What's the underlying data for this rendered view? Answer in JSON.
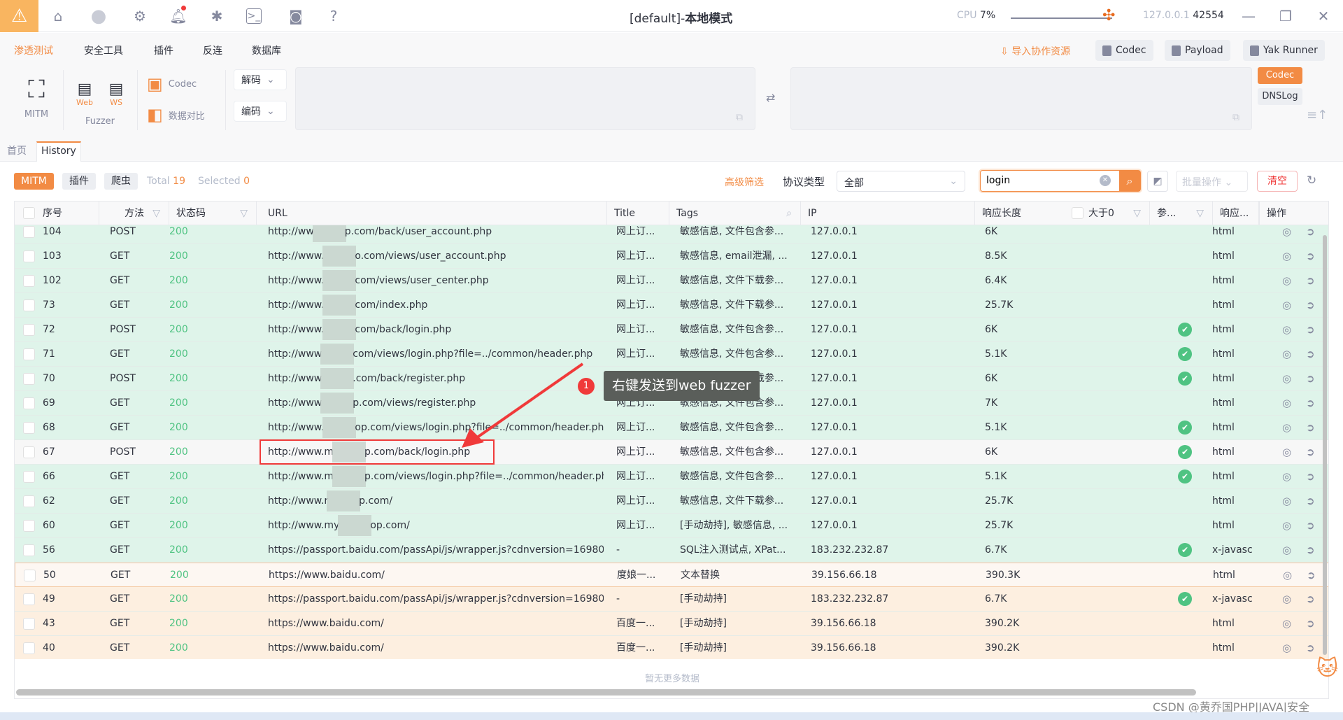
{
  "titlebar": {
    "title_prefix": "[default]-",
    "title_mode": "本地模式",
    "cpu_label": "CPU",
    "cpu_value": "7%",
    "host": "127.0.0.1",
    "port": "42554",
    "icons": [
      "warning-icon",
      "home-icon",
      "avatar-icon",
      "gear-icon",
      "bell-icon",
      "bug-icon",
      "terminal-icon",
      "camera-icon",
      "help-icon"
    ]
  },
  "menu": {
    "items": [
      "渗透测试",
      "安全工具",
      "插件",
      "反连",
      "数据库"
    ],
    "import_label": "导入协作资源",
    "buttons": [
      "Codec",
      "Payload",
      "Yak Runner"
    ]
  },
  "tools": {
    "mitm": "MITM",
    "fuzzer": "Fuzzer",
    "web": "Web",
    "ws": "WS",
    "codec": "Codec",
    "compare": "数据对比",
    "decode": "解码",
    "encode": "编码",
    "side_tabs": [
      "Codec",
      "DNSLog"
    ]
  },
  "tabs": [
    "首页",
    "History"
  ],
  "filter": {
    "pills": [
      "MITM",
      "插件",
      "爬虫"
    ],
    "total_label": "Total",
    "total": "19",
    "selected_label": "Selected",
    "selected": "0",
    "advanced": "高级筛选",
    "protocol_label": "协议类型",
    "protocol_value": "全部",
    "search_value": "login",
    "batch": "批量操作",
    "clear": "清空"
  },
  "table": {
    "headers": [
      "序号",
      "方法",
      "状态码",
      "URL",
      "Title",
      "Tags",
      "IP",
      "响应长度",
      "大于0",
      "参...",
      "响应...",
      "操作"
    ],
    "rows": [
      {
        "id": "104",
        "method": "POST",
        "status": "200",
        "url_pre": "http://ww",
        "url_suf": "p.com/back/user_account.php",
        "title": "网上订...",
        "tags": "敏感信息, 文件包含参...",
        "ip": "127.0.0.1",
        "len": "6K",
        "param": false,
        "type": "html",
        "bg": "green"
      },
      {
        "id": "103",
        "method": "GET",
        "status": "200",
        "url_pre": "http://www.",
        "url_suf": "o.com/views/user_account.php",
        "title": "网上订...",
        "tags": "敏感信息, email泄漏, ...",
        "ip": "127.0.0.1",
        "len": "8.5K",
        "param": false,
        "type": "html",
        "bg": "green"
      },
      {
        "id": "102",
        "method": "GET",
        "status": "200",
        "url_pre": "http://www.",
        "url_suf": "com/views/user_center.php",
        "title": "网上订...",
        "tags": "敏感信息, 文件下载参...",
        "ip": "127.0.0.1",
        "len": "6.4K",
        "param": false,
        "type": "html",
        "bg": "green"
      },
      {
        "id": "73",
        "method": "GET",
        "status": "200",
        "url_pre": "http://www.",
        "url_suf": "com/index.php",
        "title": "网上订...",
        "tags": "敏感信息, 文件下载参...",
        "ip": "127.0.0.1",
        "len": "25.7K",
        "param": false,
        "type": "html",
        "bg": "green"
      },
      {
        "id": "72",
        "method": "POST",
        "status": "200",
        "url_pre": "http://www.",
        "url_suf": "com/back/login.php",
        "title": "网上订...",
        "tags": "敏感信息, 文件包含参...",
        "ip": "127.0.0.1",
        "len": "6K",
        "param": true,
        "type": "html",
        "bg": "green"
      },
      {
        "id": "71",
        "method": "GET",
        "status": "200",
        "url_pre": "http://www",
        "url_suf": "com/views/login.php?file=../common/header.php",
        "title": "网上订...",
        "tags": "敏感信息, 文件包含参...",
        "ip": "127.0.0.1",
        "len": "5.1K",
        "param": true,
        "type": "html",
        "bg": "green"
      },
      {
        "id": "70",
        "method": "POST",
        "status": "200",
        "url_pre": "http://www",
        "url_suf": ".com/back/register.php",
        "title": "网上订...",
        "tags": "敏感信息, 文件下载参...",
        "ip": "127.0.0.1",
        "len": "6K",
        "param": true,
        "type": "html",
        "bg": "green"
      },
      {
        "id": "69",
        "method": "GET",
        "status": "200",
        "url_pre": "http://www",
        "url_suf": "p.com/views/register.php",
        "title": "网上订...",
        "tags": "敏感信息, 文件包含参...",
        "ip": "127.0.0.1",
        "len": "7K",
        "param": false,
        "type": "html",
        "bg": "green"
      },
      {
        "id": "68",
        "method": "GET",
        "status": "200",
        "url_pre": "http://www.",
        "url_suf": "op.com/views/login.php?file=../common/header.php",
        "title": "网上订...",
        "tags": "敏感信息, 文件包含参...",
        "ip": "127.0.0.1",
        "len": "5.1K",
        "param": true,
        "type": "html",
        "bg": "green"
      },
      {
        "id": "67",
        "method": "POST",
        "status": "200",
        "url_pre": "http://www.m",
        "url_suf": "p.com/back/login.php",
        "title": "网上订...",
        "tags": "敏感信息, 文件包含参...",
        "ip": "127.0.0.1",
        "len": "6K",
        "param": true,
        "type": "html",
        "bg": "selected"
      },
      {
        "id": "66",
        "method": "GET",
        "status": "200",
        "url_pre": "http://www.m",
        "url_suf": "p.com/views/login.php?file=../common/header.php",
        "title": "网上订...",
        "tags": "敏感信息, 文件包含参...",
        "ip": "127.0.0.1",
        "len": "5.1K",
        "param": true,
        "type": "html",
        "bg": "green"
      },
      {
        "id": "62",
        "method": "GET",
        "status": "200",
        "url_pre": "http://www.r",
        "url_suf": "p.com/",
        "title": "网上订...",
        "tags": "敏感信息, 文件下载参...",
        "ip": "127.0.0.1",
        "len": "25.7K",
        "param": false,
        "type": "html",
        "bg": "green"
      },
      {
        "id": "60",
        "method": "GET",
        "status": "200",
        "url_pre": "http://www.my",
        "url_suf": "op.com/",
        "title": "网上订...",
        "tags": "[手动劫持], 敏感信息, ...",
        "ip": "127.0.0.1",
        "len": "25.7K",
        "param": false,
        "type": "html",
        "bg": "green"
      },
      {
        "id": "56",
        "method": "GET",
        "status": "200",
        "url_pre": "https://passport.baidu.com/passApi/js/wrapper.js?cdnversion=16980...",
        "url_suf": "",
        "title": "-",
        "tags": "SQL注入测试点, XPat...",
        "ip": "183.232.232.87",
        "len": "6.7K",
        "param": true,
        "type": "x-javasc",
        "bg": "green"
      },
      {
        "id": "50",
        "method": "GET",
        "status": "200",
        "url_pre": "https://www.baidu.com/",
        "url_suf": "",
        "title": "度娘一...",
        "tags": "文本替换",
        "ip": "39.156.66.18",
        "len": "390.3K",
        "param": false,
        "type": "html",
        "bg": "hover"
      },
      {
        "id": "49",
        "method": "GET",
        "status": "200",
        "url_pre": "https://passport.baidu.com/passApi/js/wrapper.js?cdnversion=16980...",
        "url_suf": "",
        "title": "-",
        "tags": "[手动劫持]",
        "ip": "183.232.232.87",
        "len": "6.7K",
        "param": true,
        "type": "x-javasc",
        "bg": "orange"
      },
      {
        "id": "43",
        "method": "GET",
        "status": "200",
        "url_pre": "https://www.baidu.com/",
        "url_suf": "",
        "title": "百度一...",
        "tags": "[手动劫持]",
        "ip": "39.156.66.18",
        "len": "390.2K",
        "param": false,
        "type": "html",
        "bg": "orange"
      },
      {
        "id": "40",
        "method": "GET",
        "status": "200",
        "url_pre": "https://www.baidu.com/",
        "url_suf": "",
        "title": "百度一...",
        "tags": "[手动劫持]",
        "ip": "39.156.66.18",
        "len": "390.2K",
        "param": false,
        "type": "html",
        "bg": "orange"
      }
    ],
    "empty_text": "暂无更多数据"
  },
  "annotation": {
    "number": "1",
    "text": "右键发送到web fuzzer"
  },
  "watermark": "CSDN @黄乔国PHP|JAVA|安全",
  "colors": {
    "accent": "#f28b44",
    "row_green": "#dff4ea",
    "row_orange": "#fdefe0",
    "status_ok": "#4fc382",
    "annotation_red": "#f03a3a"
  }
}
